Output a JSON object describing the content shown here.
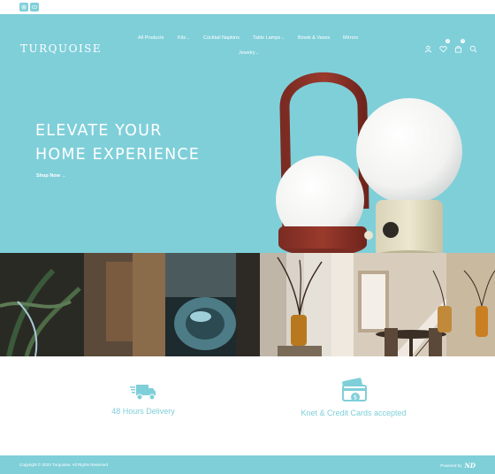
{
  "topbar": {
    "social_icons": [
      "instagram-icon",
      "youtube-icon"
    ],
    "accent_color": "#7fcfd9"
  },
  "header": {
    "logo": "TURQUOISE",
    "nav": [
      {
        "label": "All Products",
        "has_dropdown": false
      },
      {
        "label": "Kits",
        "has_dropdown": true
      },
      {
        "label": "Cocktail Napkins",
        "has_dropdown": false
      },
      {
        "label": "Table Lamps",
        "has_dropdown": true
      },
      {
        "label": "Bowls & Vases",
        "has_dropdown": false
      },
      {
        "label": "Mirrors",
        "has_dropdown": false
      },
      {
        "label": "Jewelry",
        "has_dropdown": true
      }
    ],
    "icons": [
      "account-icon",
      "wishlist-icon",
      "cart-icon",
      "search-icon"
    ],
    "wishlist_count": "0",
    "cart_count": "0"
  },
  "hero": {
    "title_line1": "ELEVATE YOUR",
    "title_line2": "HOME EXPERIENCE",
    "cta": "Shop Now",
    "cta_arrow": "→",
    "background": "#7fcfd9"
  },
  "features": [
    {
      "icon": "delivery-truck-icon",
      "label": "48 Hours Delivery"
    },
    {
      "icon": "credit-card-icon",
      "label": "Knet & Credit Cards accepted"
    }
  ],
  "footer": {
    "copyright": "Copyright © 2022 Turquoise. All Rights Reserved",
    "powered_by": "Powered by",
    "powered_logo": "ND"
  }
}
